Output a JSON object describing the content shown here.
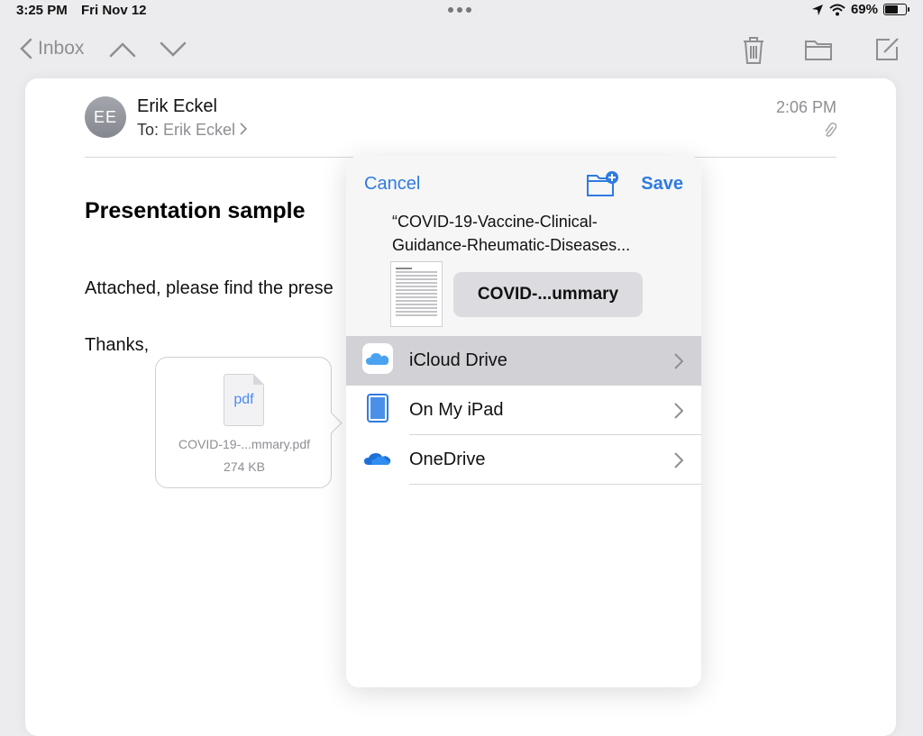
{
  "status_bar": {
    "time": "3:25 PM",
    "date": "Fri Nov 12",
    "battery": "69%",
    "battery_level": 0.69,
    "icons": [
      "location-icon",
      "wifi-icon",
      "battery-icon"
    ]
  },
  "toolbar": {
    "back_label": "Inbox",
    "icons": [
      "chevron-up-icon",
      "chevron-down-icon",
      "trash-icon",
      "folder-icon",
      "compose-icon"
    ]
  },
  "email": {
    "avatar_initials": "EE",
    "sender": "Erik Eckel",
    "to_label": "To:",
    "recipient": "Erik Eckel",
    "time": "2:06 PM",
    "subject": "Presentation sample",
    "body_line1": "Attached, please find the prese",
    "body_line2": "Thanks,",
    "attachment": {
      "type_label": "pdf",
      "name": "COVID-19-...mmary.pdf",
      "size": "274 KB"
    }
  },
  "save_sheet": {
    "cancel_label": "Cancel",
    "save_label": "Save",
    "file_title_line1": "“COVID-19-Vaccine-Clinical-",
    "file_title_line2": "Guidance-Rheumatic-Diseases...",
    "filename_value": "COVID-...ummary",
    "locations": [
      {
        "label": "iCloud Drive",
        "icon": "icloud-icon",
        "selected": true
      },
      {
        "label": "On My iPad",
        "icon": "ipad-icon",
        "selected": false
      },
      {
        "label": "OneDrive",
        "icon": "onedrive-icon",
        "selected": false
      }
    ]
  },
  "colors": {
    "accent": "#2f7be0",
    "selected_row": "#d1d1d6",
    "secondary_text": "#8e8e93"
  }
}
